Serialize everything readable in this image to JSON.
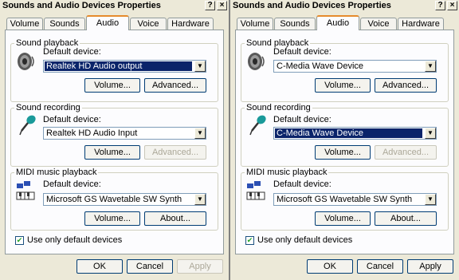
{
  "windows": [
    {
      "title": "Sounds and Audio Devices Properties",
      "controls": [
        "?",
        "×"
      ],
      "tabs": [
        "Volume",
        "Sounds",
        "Audio",
        "Voice",
        "Hardware"
      ],
      "active_tab": "Audio",
      "playback": {
        "group_label": "Sound playback",
        "default_label": "Default device:",
        "device": "Realtek HD Audio output",
        "volume_button": "Volume...",
        "advanced_button": "Advanced..."
      },
      "recording": {
        "group_label": "Sound recording",
        "default_label": "Default device:",
        "device": "Realtek HD Audio Input",
        "volume_button": "Volume...",
        "advanced_button": "Advanced..."
      },
      "midi": {
        "group_label": "MIDI music playback",
        "default_label": "Default device:",
        "device": "Microsoft GS Wavetable SW Synth",
        "volume_button": "Volume...",
        "about_button": "About..."
      },
      "use_only_default_label": "Use only default devices",
      "use_only_default_checked": true,
      "ok_button": "OK",
      "cancel_button": "Cancel",
      "apply_button": "Apply"
    },
    {
      "title": "Sounds and Audio Devices Properties",
      "controls": [
        "?",
        "×"
      ],
      "tabs": [
        "Volume",
        "Sounds",
        "Audio",
        "Voice",
        "Hardware"
      ],
      "active_tab": "Audio",
      "playback": {
        "group_label": "Sound playback",
        "default_label": "Default device:",
        "device": "C-Media Wave Device",
        "volume_button": "Volume...",
        "advanced_button": "Advanced..."
      },
      "recording": {
        "group_label": "Sound recording",
        "default_label": "Default device:",
        "device": "C-Media Wave Device",
        "volume_button": "Volume...",
        "advanced_button": "Advanced..."
      },
      "midi": {
        "group_label": "MIDI music playback",
        "default_label": "Default device:",
        "device": "Microsoft GS Wavetable SW Synth",
        "volume_button": "Volume...",
        "about_button": "About..."
      },
      "use_only_default_label": "Use only default devices",
      "use_only_default_checked": true,
      "ok_button": "OK",
      "cancel_button": "Cancel",
      "apply_button": "Apply"
    }
  ]
}
